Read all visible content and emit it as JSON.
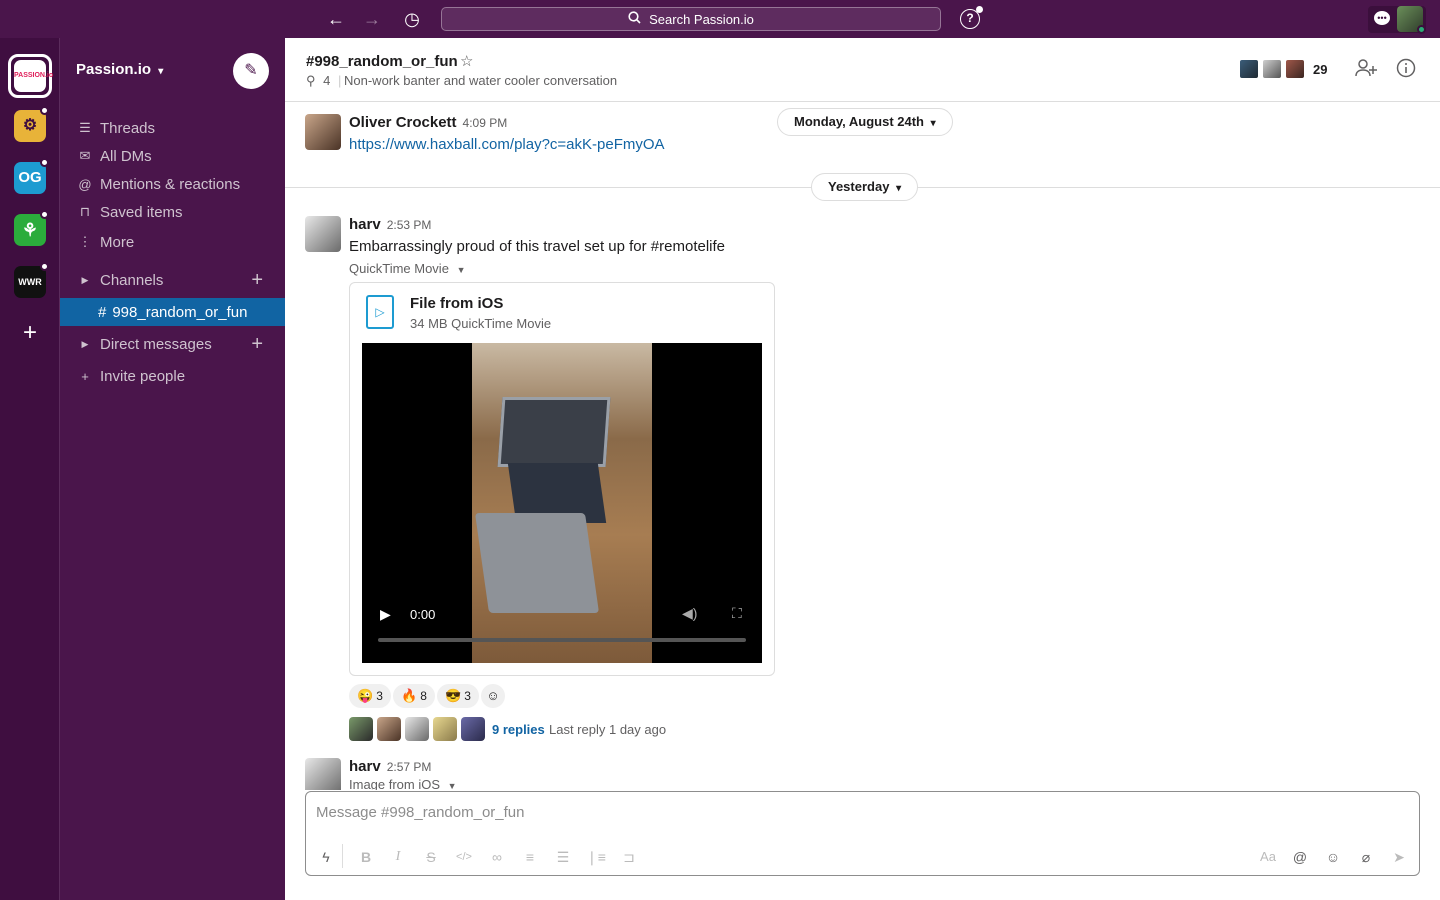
{
  "topbar": {
    "back_icon": "←",
    "forward_icon": "→",
    "history_icon": "◷",
    "search_placeholder": "Search Passion.io",
    "help_icon": "?"
  },
  "rail": {
    "workspaces": [
      {
        "label": "Passion.io",
        "abbr": "PASSION.io",
        "color": "#ffffff"
      },
      {
        "label": "Workspace 2",
        "abbr": "⚙",
        "color": "#e8b339"
      },
      {
        "label": "OG",
        "abbr": "OG",
        "color": "#1d9bd1"
      },
      {
        "label": "Workspace 4",
        "abbr": "⚘",
        "color": "#2bac3c"
      },
      {
        "label": "WWR",
        "abbr": "WWR",
        "color": "#111111"
      }
    ],
    "add_icon": "+"
  },
  "sidebar": {
    "workspace_name": "Passion.io",
    "compose_icon": "✎",
    "nav": [
      {
        "label": "Threads",
        "icon": "☰"
      },
      {
        "label": "All DMs",
        "icon": "✉"
      },
      {
        "label": "Mentions & reactions",
        "icon": "@"
      },
      {
        "label": "Saved items",
        "icon": "⊓"
      },
      {
        "label": "More",
        "icon": "⋮"
      }
    ],
    "channels_label": "Channels",
    "active_channel": "998_random_or_fun",
    "dms_label": "Direct messages",
    "invite_label": "Invite people"
  },
  "channel": {
    "title": "#998_random_or_fun",
    "pins": "4",
    "topic": "Non-work banter and water cooler conversation",
    "member_count": "29"
  },
  "messages": {
    "date_pill_1": "Monday, August 24th",
    "date_pill_2": "Yesterday",
    "msg1": {
      "author": "Oliver Crockett",
      "time": "4:09 PM",
      "link": "https://www.haxball.com/play?c=akK-peFmyOA"
    },
    "msg2": {
      "author": "harv",
      "time": "2:53 PM",
      "text": "Embarrassingly proud of this travel set up for #remotelife",
      "file_meta": "QuickTime Movie",
      "file_name": "File from iOS",
      "file_size": "34 MB QuickTime Movie",
      "video_time": "0:00",
      "reactions": [
        {
          "emoji": "😜",
          "count": "3"
        },
        {
          "emoji": "🔥",
          "count": "8"
        },
        {
          "emoji": "😎",
          "count": "3"
        }
      ],
      "replies": "9 replies",
      "last_reply": "Last reply 1 day ago"
    },
    "msg3": {
      "author": "harv",
      "time": "2:57 PM",
      "file_meta": "Image from iOS"
    }
  },
  "composer": {
    "placeholder": "Message #998_random_or_fun",
    "format_label": "Aa"
  },
  "colors": {
    "aubergine": "#4a154b",
    "rail": "#3f0e40",
    "active_blue": "#1164a3",
    "link": "#1264a3"
  }
}
